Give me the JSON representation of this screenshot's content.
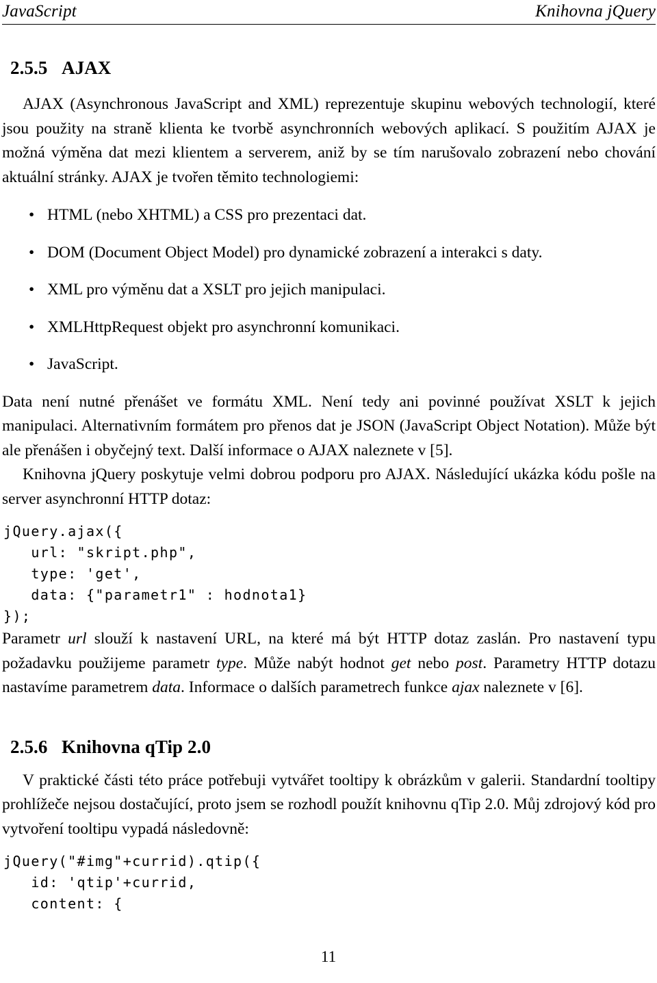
{
  "document": {
    "header": {
      "left": "JavaScript",
      "right": "Knihovna jQuery"
    },
    "page_number": "11",
    "sections": [
      {
        "number": "2.5.5",
        "title": "AJAX"
      },
      {
        "number": "2.5.6",
        "title": "Knihovna qTip 2.0"
      }
    ],
    "paragraphs": {
      "ajax_intro": "AJAX (Asynchronous JavaScript and XML) reprezentuje skupinu webových technologií, které jsou použity na straně klienta ke tvorbě asynchronních webových aplikací. S použitím AJAX je možná výměna dat mezi klientem a serverem, aniž by se tím narušovalo zobrazení nebo chování aktuální stránky. AJAX je tvořen těmito technologiemi:",
      "data_format_1": "Data není nutné přenášet ve formátu XML. Není tedy ani povinné používat XSLT k jejich manipulaci. Alternativním formátem pro přenos dat je JSON (JavaScript Object Notation). Může být ale přenášen i obyčejný text. Další informace o AJAX naleznete v [5].",
      "jquery_support": "Knihovna jQuery poskytuje velmi dobrou podporu pro AJAX. Následující ukázka kódu pošle na server asynchronní HTTP dotaz:",
      "params_part1": "Parametr ",
      "params_it1": "url",
      "params_part2": " slouží k nastavení URL, na které má být HTTP dotaz zaslán. Pro nastavení typu požadavku použijeme parametr ",
      "params_it2": "type",
      "params_part3": ". Může nabýt hodnot ",
      "params_it3": "get",
      "params_part4": " nebo ",
      "params_it4": "post",
      "params_part5": ". Parametry HTTP dotazu nastavíme parametrem ",
      "params_it5": "data",
      "params_part6": ". Informace o dalších parametrech funkce ",
      "params_it6": "ajax",
      "params_part7": " naleznete v [6].",
      "qtip_intro": "V praktické části této práce potřebuji vytvářet tooltipy k obrázkům v galerii. Standardní tooltipy prohlížeče nejsou dostačující, proto jsem se rozhodl použít knihovnu qTip 2.0. Můj zdrojový kód pro vytvoření tooltipu vypadá následovně:"
    },
    "bullets": [
      {
        "marker": "•",
        "text": "HTML (nebo XHTML) a CSS pro prezentaci dat."
      },
      {
        "marker": "•",
        "text": "DOM (Document Object Model) pro dynamické zobrazení a interakci s daty."
      },
      {
        "marker": "•",
        "text": "XML pro výměnu dat a XSLT pro jejich manipulaci."
      },
      {
        "marker": "•",
        "text": "XMLHttpRequest objekt pro asynchronní komunikaci."
      },
      {
        "marker": "•",
        "text": "JavaScript."
      }
    ],
    "code_blocks": {
      "ajax_call": "jQuery.ajax({\n   url: \"skript.php\",\n   type: 'get',\n   data: {\"parametr1\" : hodnota1}\n});",
      "qtip_call": "jQuery(\"#img\"+currid).qtip({\n   id: 'qtip'+currid,\n   content: {"
    }
  }
}
